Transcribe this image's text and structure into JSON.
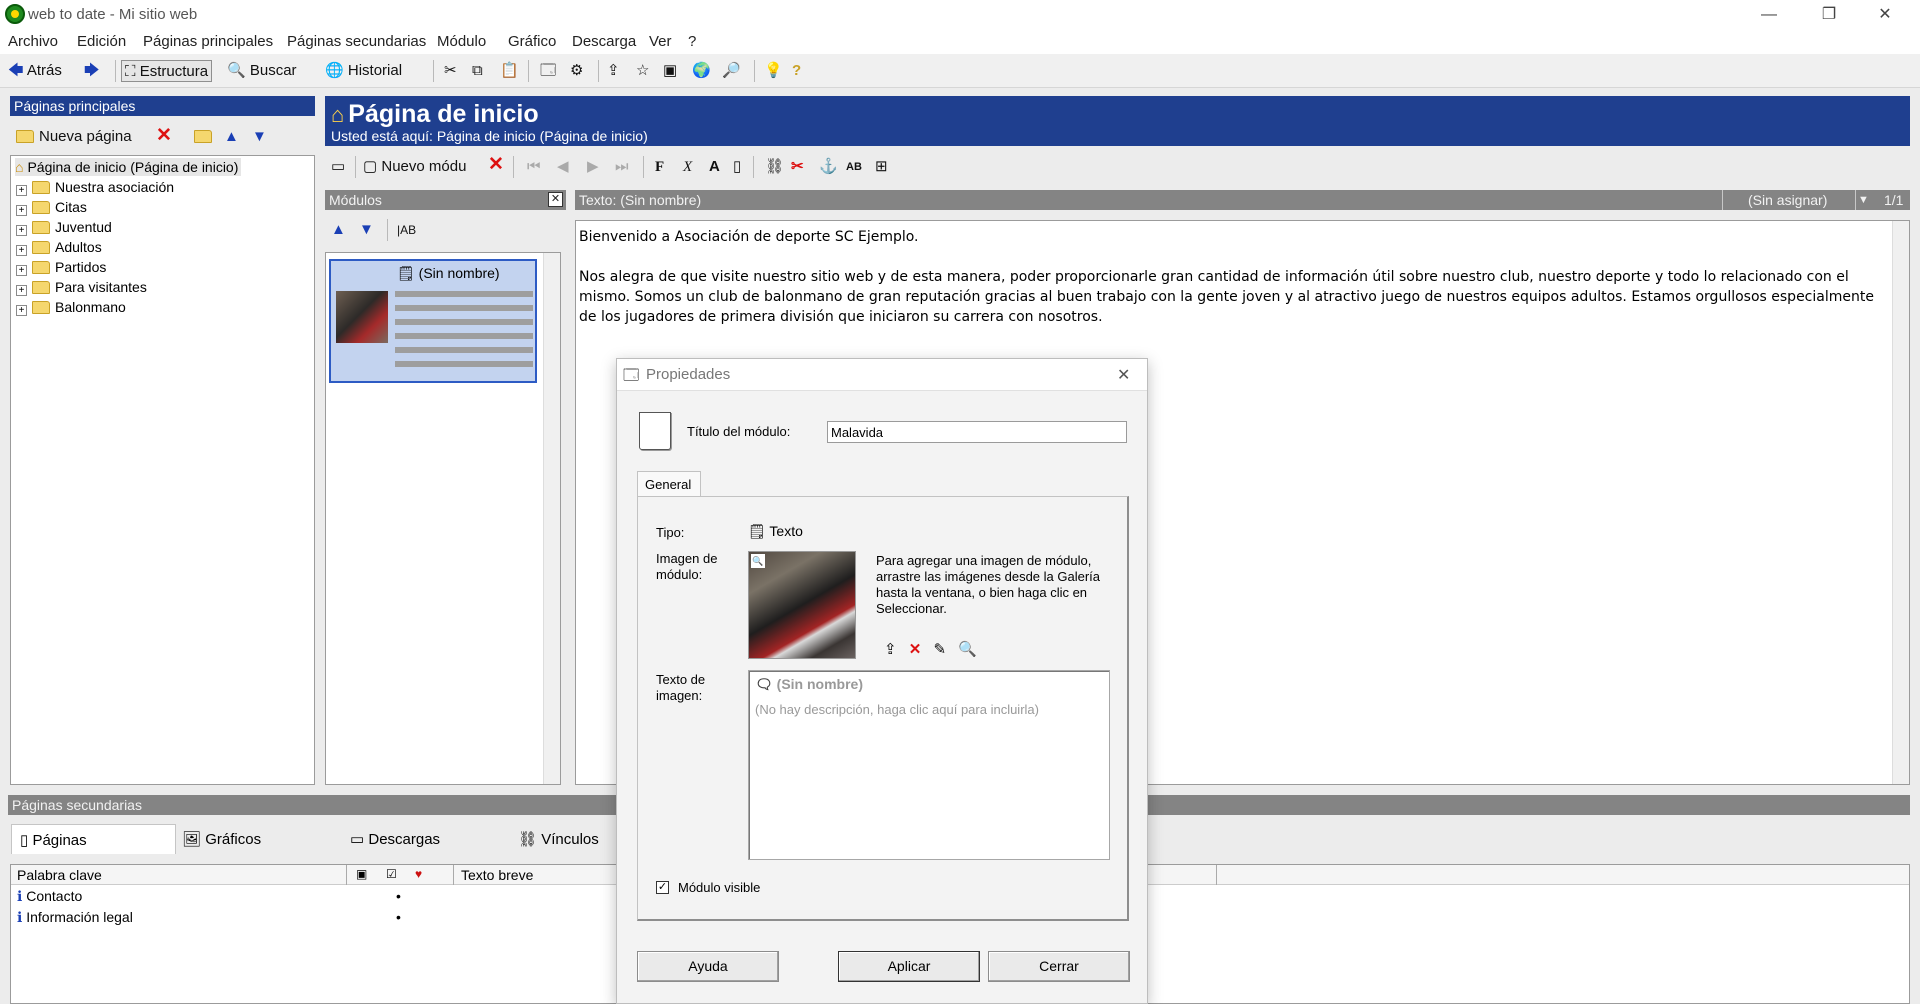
{
  "window": {
    "title": "web to date - Mi sitio web",
    "minimize": "—",
    "restore": "❐",
    "close": "✕"
  },
  "menu": [
    "Archivo",
    "Edición",
    "Páginas principales",
    "Páginas secundarias",
    "Módulo",
    "Gráfico",
    "Descarga",
    "Ver",
    "?"
  ],
  "toolbar": {
    "back": "Atrás",
    "structure": "Estructura",
    "search": "Buscar",
    "history": "Historial"
  },
  "left_panel": {
    "header": "Páginas principales",
    "new_page": "Nueva página",
    "tree_root": "Página de inicio (Página de inicio)",
    "tree_items": [
      "Nuestra asociación",
      "Citas",
      "Juventud",
      "Adultos",
      "Partidos",
      "Para visitantes",
      "Balonmano"
    ]
  },
  "page_header": {
    "title": "Página de inicio",
    "breadcrumb": "Usted está aquí: Página de inicio (Página de inicio)"
  },
  "editor_toolbar": {
    "new_module": "Nuevo módu"
  },
  "modules_panel": {
    "header": "Módulos",
    "close": "✕",
    "module_name": "(Sin nombre)"
  },
  "text_panel": {
    "header": "Texto: (Sin nombre)",
    "assign": "(Sin asignar)",
    "page_count": "1/1",
    "para1": "Bienvenido a Asociación de deporte SC Ejemplo.",
    "para2": "Nos alegra de que visite nuestro sitio web y de esta manera, poder proporcionarle gran cantidad de información útil sobre nuestro club, nuestro deporte y todo lo relacionado con el mismo. Somos un club de balonmano de gran reputación gracias al buen trabajo con la gente joven y al atractivo juego de nuestros equipos adultos. Estamos orgullosos especialmente de los jugadores de primera división que iniciaron su carrera con nosotros."
  },
  "secondary": {
    "header": "Páginas secundarias",
    "tabs": [
      "Páginas",
      "Gráficos",
      "Descargas",
      "Vínculos"
    ],
    "columns": {
      "keyword": "Palabra clave",
      "short_text": "Texto breve"
    },
    "rows": [
      {
        "name": "Contacto",
        "dot": "•"
      },
      {
        "name": "Información legal",
        "dot": "•"
      }
    ]
  },
  "dialog": {
    "title": "Propiedades",
    "close": "✕",
    "module_title_label": "Título del módulo:",
    "module_title_value": "Malavida",
    "tab": "General",
    "type_label": "Tipo:",
    "type_value": "Texto",
    "image_label_1": "Imagen de",
    "image_label_2": "módulo:",
    "image_help": "Para agregar una imagen de módulo, arrastre las imágenes desde la Galería hasta la ventana, o bien haga clic en Seleccionar.",
    "image_text_label_1": "Texto de",
    "image_text_label_2": "imagen:",
    "image_text_name": "(Sin nombre)",
    "image_text_desc": "(No hay descripción, haga clic aquí para incluirla)",
    "visible_check": "✓",
    "visible_label": "Módulo visible",
    "buttons": {
      "help": "Ayuda",
      "apply": "Aplicar",
      "close": "Cerrar"
    }
  },
  "colors": {
    "nav_blue": "#1f3f8f",
    "header_gray": "#848484",
    "accent_red": "#dd1111"
  }
}
